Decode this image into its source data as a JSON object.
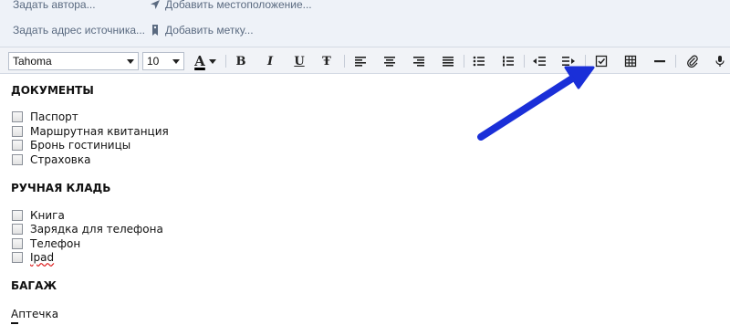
{
  "meta": {
    "author_label": "Задать автора...",
    "location_label": "Добавить местоположение...",
    "source_label": "Задать адрес источника...",
    "tag_label": "Добавить метку..."
  },
  "toolbar": {
    "font_name": "Tahoma",
    "font_size": "10",
    "bold_glyph": "B",
    "italic_glyph": "I",
    "underline_glyph": "U",
    "strike_glyph": "Ŧ",
    "text_color_glyph": "A",
    "accent_color": "#c8102e"
  },
  "content": {
    "sections": [
      {
        "title": "ДОКУМЕНТЫ",
        "items": [
          "Паспорт",
          "Маршрутная квитанция",
          "Бронь гостиницы",
          "Страховка"
        ]
      },
      {
        "title": "РУЧНАЯ КЛАДЬ",
        "items": [
          "Книга",
          "Зарядка для телефона",
          "Телефон",
          "Ipad"
        ]
      },
      {
        "title": "БАГАЖ",
        "items": []
      }
    ],
    "plain_text": "Аптечка"
  },
  "annotation": {
    "arrow_color": "#1a2fd8"
  }
}
